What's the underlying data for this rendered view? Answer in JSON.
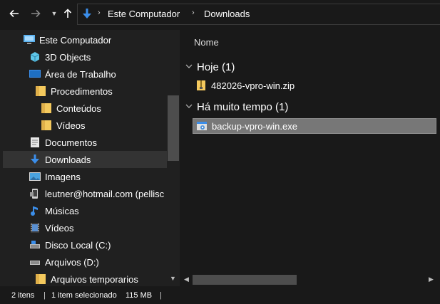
{
  "toolbar": {
    "back_icon": "arrow-left-icon",
    "forward_icon": "arrow-right-icon",
    "up_icon": "arrow-up-icon",
    "breadcrumb": [
      "Este Computador",
      "Downloads"
    ]
  },
  "navpane": {
    "items": [
      {
        "label": "Este Computador",
        "icon": "computer-icon"
      },
      {
        "label": "3D Objects",
        "icon": "cube-icon"
      },
      {
        "label": "Área de Trabalho",
        "icon": "desktop-icon"
      },
      {
        "label": "Procedimentos",
        "icon": "folder-icon"
      },
      {
        "label": "Conteúdos",
        "icon": "folder-icon"
      },
      {
        "label": "Vídeos",
        "icon": "folder-icon"
      },
      {
        "label": "Documentos",
        "icon": "document-icon"
      },
      {
        "label": "Downloads",
        "icon": "download-icon",
        "selected": true
      },
      {
        "label": "Imagens",
        "icon": "image-icon"
      },
      {
        "label": "leutner@hotmail.com (pellisc",
        "icon": "phone-icon"
      },
      {
        "label": "Músicas",
        "icon": "music-icon"
      },
      {
        "label": "Vídeos",
        "icon": "video-icon"
      },
      {
        "label": "Disco Local (C:)",
        "icon": "drive-icon"
      },
      {
        "label": "Arquivos (D:)",
        "icon": "drive-icon"
      },
      {
        "label": "Arquivos temporarios",
        "icon": "folder-icon"
      }
    ]
  },
  "content": {
    "column_header": "Nome",
    "groups": [
      {
        "title": "Hoje (1)",
        "files": [
          {
            "name": "482026-vpro-win.zip",
            "icon": "zip-icon"
          }
        ]
      },
      {
        "title": "Há muito tempo (1)",
        "files": [
          {
            "name": "backup-vpro-win.exe",
            "icon": "exe-icon",
            "selected": true
          }
        ]
      }
    ]
  },
  "status": {
    "count": "2 itens",
    "selected": "1 item selecionado",
    "size": "115 MB",
    "sep": "|"
  },
  "colors": {
    "background": "#191919",
    "navpane": "#202020",
    "selected_nav": "#333333",
    "selected_file": "#777777",
    "folder": "#f4c95d",
    "accent_blue": "#3b8eea"
  }
}
